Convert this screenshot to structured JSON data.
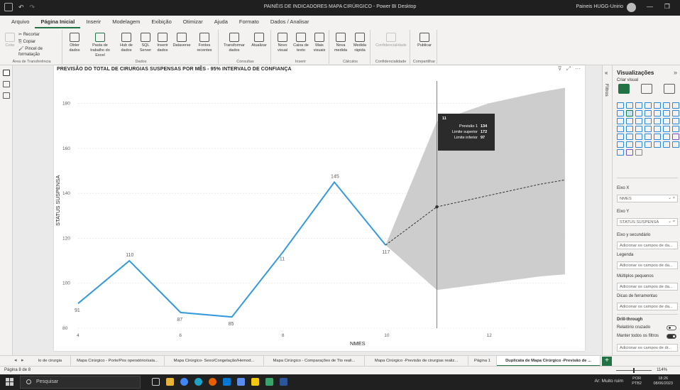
{
  "window": {
    "title": "PAINÉIS DE INDICADORES MAPA CIRÚRGICO - Power BI Desktop",
    "user": "Paineis HUGG-Unirio"
  },
  "menu": {
    "tabs": [
      {
        "label": "Arquivo"
      },
      {
        "label": "Página Inicial"
      },
      {
        "label": "Inserir"
      },
      {
        "label": "Modelagem"
      },
      {
        "label": "Exibição"
      },
      {
        "label": "Otimizar"
      },
      {
        "label": "Ajuda"
      },
      {
        "label": "Formato"
      },
      {
        "label": "Dados / Analisar"
      }
    ]
  },
  "ribbon": {
    "clipboard": {
      "paste": "Colar",
      "cut": "Recortar",
      "copy": "Copiar",
      "format_painter": "Pincel de formatação",
      "group": "Área de Transferência"
    },
    "data": {
      "get_data": "Obter dados",
      "excel": "Pasta de trabalho do Excel",
      "hub": "Hub de dados",
      "sql": "SQL Server",
      "enter": "Inserir dados",
      "dataverse": "Dataverse",
      "recent": "Fontes recentes",
      "group": "Dados"
    },
    "queries": {
      "transform": "Transformar dados",
      "refresh": "Atualizar",
      "group": "Consultas"
    },
    "insert": {
      "visual": "Novo visual",
      "textbox": "Caixa de texto",
      "more": "Mais visuais",
      "group": "Inserir"
    },
    "calc": {
      "measure": "Nova medida",
      "quick": "Medida rápida",
      "group": "Cálculos"
    },
    "sens": {
      "label": "Confidencialidade",
      "group": "Confidencialidade"
    },
    "share": {
      "publish": "Publicar",
      "group": "Compartilhar"
    }
  },
  "visual": {
    "title": "PREVISÃO DO TOTAL DE CIRURGIAS SUSPENSAS POR MÊS - 95% INTERVALO DE CONFIANÇA",
    "header_icons": [
      "filter-icon",
      "focus-icon",
      "more-icon"
    ]
  },
  "chart_data": {
    "type": "line",
    "title": "PREVISÃO DO TOTAL DE CIRURGIAS SUSPENSAS POR MÊS - 95% INTERVALO DE CONFIANÇA",
    "xlabel": "NMES",
    "ylabel": "STATUS SUSPENSA",
    "xlim": [
      4,
      13.5
    ],
    "ylim": [
      80,
      190
    ],
    "x_ticks": [
      4,
      6,
      8,
      10,
      12
    ],
    "y_ticks": [
      80,
      100,
      120,
      140,
      160,
      180
    ],
    "grid": true,
    "series": [
      {
        "kind": "actual",
        "color": "#3599dd",
        "x": [
          4,
          5,
          6,
          7,
          8,
          9,
          10
        ],
        "values": [
          91,
          110,
          87,
          85,
          114,
          145,
          117
        ],
        "labels": [
          "91",
          "110",
          "87",
          "85",
          "11",
          "145",
          "117"
        ]
      },
      {
        "kind": "forecast",
        "color": "#333333",
        "x": [
          10,
          11,
          12,
          13,
          13.5
        ],
        "values": [
          117,
          134,
          139,
          144,
          146
        ]
      }
    ],
    "confidence_band": {
      "color": "#c8c8c8",
      "x": [
        10,
        11,
        12,
        13,
        13.5
      ],
      "upper": [
        117,
        172,
        180,
        185,
        187
      ],
      "lower": [
        117,
        97,
        100,
        103,
        104
      ]
    },
    "hover_x": 11,
    "tooltip": {
      "header": "11",
      "rows": [
        {
          "label": "Previsão 1",
          "value": "134"
        },
        {
          "label": "Limite superior",
          "value": "172"
        },
        {
          "label": "Limite inferior",
          "value": "97"
        }
      ]
    }
  },
  "panes": {
    "filters_label": "Filtros",
    "viz_title": "Visualizações",
    "build_visual": "Criar visual",
    "fields": [
      {
        "label": "Eixo X",
        "value": "NMES"
      },
      {
        "label": "Eixo Y",
        "value": "STATUS SUSPENSA"
      },
      {
        "label": "Eixo y secundário",
        "value": "Adicionar os campos de da..."
      },
      {
        "label": "Legenda",
        "value": "Adicionar os campos de da..."
      },
      {
        "label": "Múltiplos pequenos",
        "value": "Adicionar os campos de da..."
      },
      {
        "label": "Dicas de ferramentas",
        "value": "Adicionar os campos de da..."
      }
    ],
    "drillthrough": {
      "title": "Drill-through",
      "cross_report": "Relatório cruzado",
      "keep_filters": "Manter todos os filtros",
      "add": "Adicionar os campos de dr..."
    }
  },
  "page_tabs": [
    "lo de cirurgia",
    "Mapa Cirúrgico - Porte/Pos operatório/sala...",
    "Mapa Cirúrgico- Sexo/Congelação/Hemod...",
    "Mapa Cirúrgico - Comparações de Tto reali...",
    "Mapa Cirúrgico -Previsão de cirurgias realiz...",
    "Página 1",
    "Duplicata de Mapa Cirúrgico -Previsão de ..."
  ],
  "status": {
    "page": "Página 8 de 8",
    "zoom": "114%"
  },
  "taskbar": {
    "search": "Pesquisar",
    "weather": "Ar: Muito ruim",
    "lang1": "POR",
    "lang2": "PTB2",
    "time": "18:26",
    "date": "08/06/2023"
  }
}
